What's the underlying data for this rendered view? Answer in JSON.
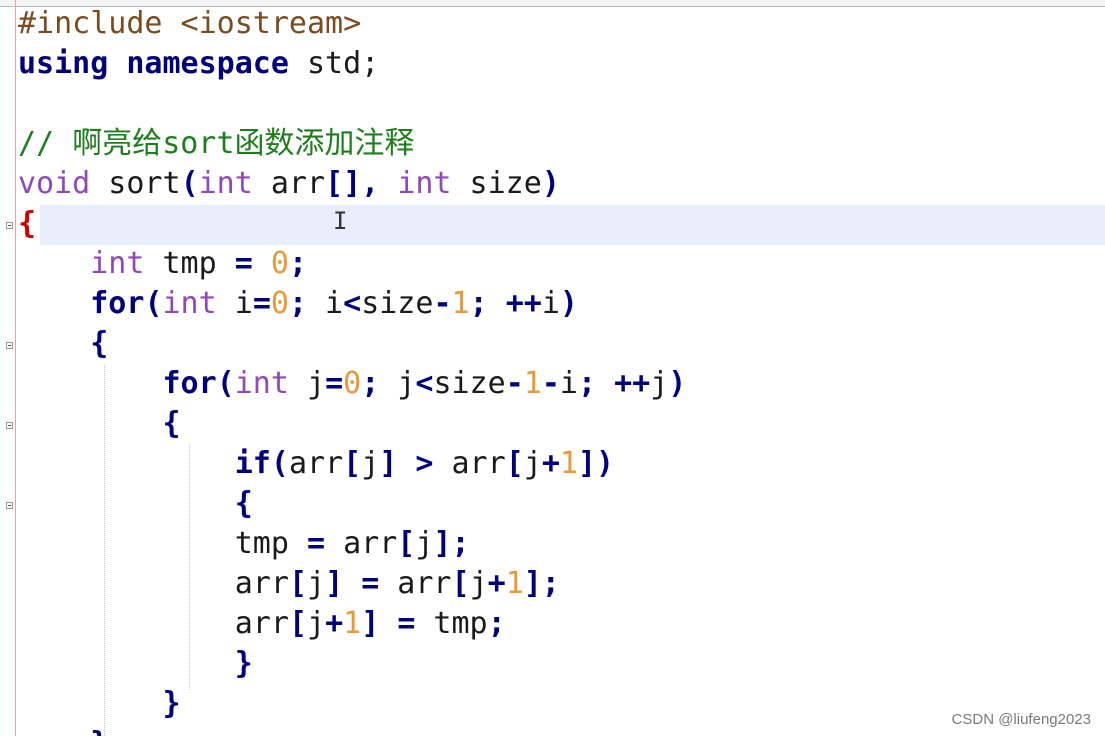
{
  "editor": {
    "lines": [
      [
        {
          "t": "pp",
          "v": "#include <iostream>"
        }
      ],
      [
        {
          "t": "kw",
          "v": "using"
        },
        {
          "t": "txt",
          "v": " "
        },
        {
          "t": "kw",
          "v": "namespace"
        },
        {
          "t": "txt",
          "v": " std;"
        }
      ],
      [],
      [
        {
          "t": "cmt",
          "v": "// "
        },
        {
          "t": "cmt-cjk",
          "v": "啊亮给"
        },
        {
          "t": "cmt",
          "v": "sort"
        },
        {
          "t": "cmt-cjk",
          "v": "函数添加注释"
        }
      ],
      [
        {
          "t": "type",
          "v": "void"
        },
        {
          "t": "txt",
          "v": " sort"
        },
        {
          "t": "op",
          "v": "("
        },
        {
          "t": "type",
          "v": "int"
        },
        {
          "t": "txt",
          "v": " arr"
        },
        {
          "t": "op",
          "v": "[],"
        },
        {
          "t": "txt",
          "v": " "
        },
        {
          "t": "type",
          "v": "int"
        },
        {
          "t": "txt",
          "v": " size"
        },
        {
          "t": "op",
          "v": ")"
        }
      ],
      [
        {
          "t": "brace-hl",
          "v": "{"
        }
      ],
      [
        {
          "t": "txt",
          "v": "    "
        },
        {
          "t": "type",
          "v": "int"
        },
        {
          "t": "txt",
          "v": " tmp "
        },
        {
          "t": "op",
          "v": "="
        },
        {
          "t": "txt",
          "v": " "
        },
        {
          "t": "num",
          "v": "0"
        },
        {
          "t": "op",
          "v": ";"
        }
      ],
      [
        {
          "t": "txt",
          "v": "    "
        },
        {
          "t": "kw",
          "v": "for"
        },
        {
          "t": "op",
          "v": "("
        },
        {
          "t": "type",
          "v": "int"
        },
        {
          "t": "txt",
          "v": " i"
        },
        {
          "t": "op",
          "v": "="
        },
        {
          "t": "num",
          "v": "0"
        },
        {
          "t": "op",
          "v": ";"
        },
        {
          "t": "txt",
          "v": " i"
        },
        {
          "t": "op",
          "v": "<"
        },
        {
          "t": "txt",
          "v": "size"
        },
        {
          "t": "op",
          "v": "-"
        },
        {
          "t": "num",
          "v": "1"
        },
        {
          "t": "op",
          "v": ";"
        },
        {
          "t": "txt",
          "v": " "
        },
        {
          "t": "op",
          "v": "++"
        },
        {
          "t": "txt",
          "v": "i"
        },
        {
          "t": "op",
          "v": ")"
        }
      ],
      [
        {
          "t": "txt",
          "v": "    "
        },
        {
          "t": "brace",
          "v": "{"
        }
      ],
      [
        {
          "t": "txt",
          "v": "        "
        },
        {
          "t": "kw",
          "v": "for"
        },
        {
          "t": "op",
          "v": "("
        },
        {
          "t": "type",
          "v": "int"
        },
        {
          "t": "txt",
          "v": " j"
        },
        {
          "t": "op",
          "v": "="
        },
        {
          "t": "num",
          "v": "0"
        },
        {
          "t": "op",
          "v": ";"
        },
        {
          "t": "txt",
          "v": " j"
        },
        {
          "t": "op",
          "v": "<"
        },
        {
          "t": "txt",
          "v": "size"
        },
        {
          "t": "op",
          "v": "-"
        },
        {
          "t": "num",
          "v": "1"
        },
        {
          "t": "op",
          "v": "-"
        },
        {
          "t": "txt",
          "v": "i"
        },
        {
          "t": "op",
          "v": ";"
        },
        {
          "t": "txt",
          "v": " "
        },
        {
          "t": "op",
          "v": "++"
        },
        {
          "t": "txt",
          "v": "j"
        },
        {
          "t": "op",
          "v": ")"
        }
      ],
      [
        {
          "t": "txt",
          "v": "        "
        },
        {
          "t": "brace",
          "v": "{"
        }
      ],
      [
        {
          "t": "txt",
          "v": "            "
        },
        {
          "t": "kw",
          "v": "if"
        },
        {
          "t": "op",
          "v": "("
        },
        {
          "t": "txt",
          "v": "arr"
        },
        {
          "t": "op",
          "v": "["
        },
        {
          "t": "txt",
          "v": "j"
        },
        {
          "t": "op",
          "v": "]"
        },
        {
          "t": "txt",
          "v": " "
        },
        {
          "t": "op",
          "v": ">"
        },
        {
          "t": "txt",
          "v": " arr"
        },
        {
          "t": "op",
          "v": "["
        },
        {
          "t": "txt",
          "v": "j"
        },
        {
          "t": "op",
          "v": "+"
        },
        {
          "t": "num",
          "v": "1"
        },
        {
          "t": "op",
          "v": "])"
        }
      ],
      [
        {
          "t": "txt",
          "v": "            "
        },
        {
          "t": "brace",
          "v": "{"
        }
      ],
      [
        {
          "t": "txt",
          "v": "            tmp "
        },
        {
          "t": "op",
          "v": "="
        },
        {
          "t": "txt",
          "v": " arr"
        },
        {
          "t": "op",
          "v": "["
        },
        {
          "t": "txt",
          "v": "j"
        },
        {
          "t": "op",
          "v": "];"
        }
      ],
      [
        {
          "t": "txt",
          "v": "            arr"
        },
        {
          "t": "op",
          "v": "["
        },
        {
          "t": "txt",
          "v": "j"
        },
        {
          "t": "op",
          "v": "]"
        },
        {
          "t": "txt",
          "v": " "
        },
        {
          "t": "op",
          "v": "="
        },
        {
          "t": "txt",
          "v": " arr"
        },
        {
          "t": "op",
          "v": "["
        },
        {
          "t": "txt",
          "v": "j"
        },
        {
          "t": "op",
          "v": "+"
        },
        {
          "t": "num",
          "v": "1"
        },
        {
          "t": "op",
          "v": "];"
        }
      ],
      [
        {
          "t": "txt",
          "v": "            arr"
        },
        {
          "t": "op",
          "v": "["
        },
        {
          "t": "txt",
          "v": "j"
        },
        {
          "t": "op",
          "v": "+"
        },
        {
          "t": "num",
          "v": "1"
        },
        {
          "t": "op",
          "v": "]"
        },
        {
          "t": "txt",
          "v": " "
        },
        {
          "t": "op",
          "v": "="
        },
        {
          "t": "txt",
          "v": " tmp"
        },
        {
          "t": "op",
          "v": ";"
        }
      ],
      [
        {
          "t": "txt",
          "v": "            "
        },
        {
          "t": "brace",
          "v": "}"
        }
      ],
      [
        {
          "t": "txt",
          "v": "        "
        },
        {
          "t": "brace",
          "v": "}"
        }
      ],
      [
        {
          "t": "txt",
          "v": "    "
        },
        {
          "t": "brace",
          "v": "}"
        }
      ]
    ],
    "cursor_glyph": "I",
    "fold_marker_icon": "fold-minus-icon"
  },
  "watermark": {
    "text": "CSDN @liufeng2023"
  },
  "colors": {
    "preprocessor": "#7a4b1e",
    "keyword": "#00007f",
    "type": "#8f4ab8",
    "number": "#e89a3a",
    "comment": "#1e7e1e",
    "current_line": "#e8eefb",
    "matching_brace": "#d00000"
  }
}
